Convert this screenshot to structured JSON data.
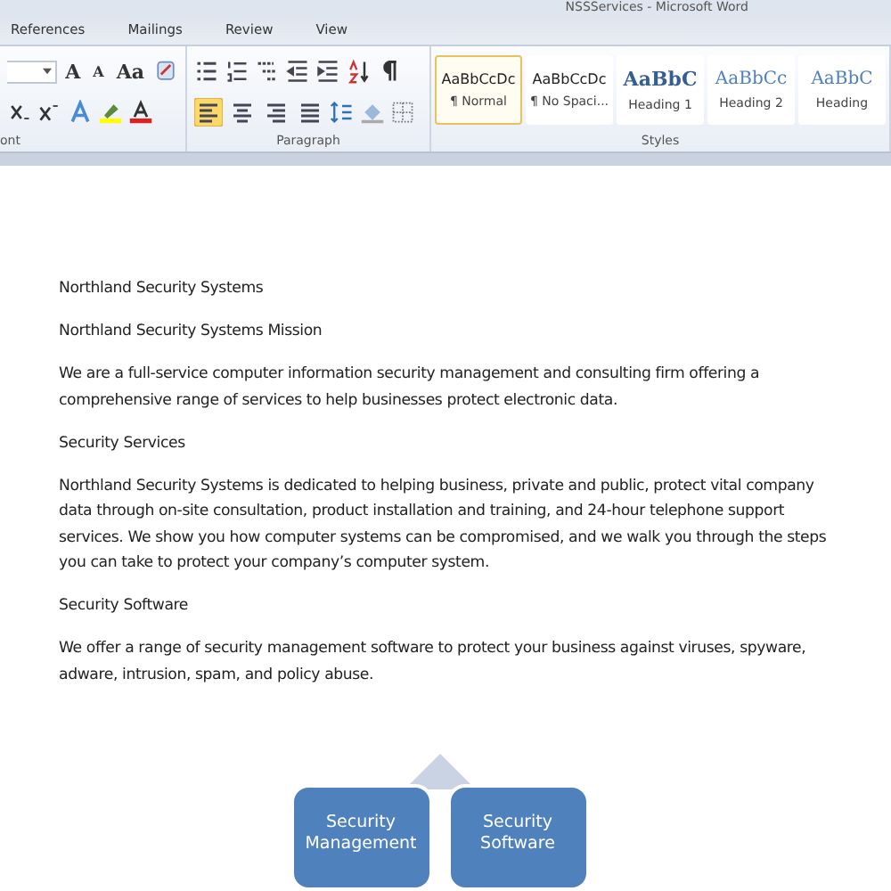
{
  "window": {
    "title": "NSSServices - Microsoft Word"
  },
  "ribbon_tabs": [
    {
      "label": "References",
      "selected": false
    },
    {
      "label": "Mailings",
      "selected": false
    },
    {
      "label": "Review",
      "selected": false
    },
    {
      "label": "View",
      "selected": false
    }
  ],
  "font_group": {
    "label": "ont",
    "tools": [
      "A",
      "A",
      "Aa"
    ]
  },
  "paragraph_group": {
    "label": "Paragraph",
    "alignment": [
      {
        "selected": true
      },
      {
        "selected": false
      },
      {
        "selected": false
      },
      {
        "selected": false
      }
    ]
  },
  "styles_group": {
    "label": "Styles",
    "styles": [
      {
        "preview": "AaBbCcDc",
        "name": "¶ Normal",
        "kind": "body",
        "selected": true
      },
      {
        "preview": "AaBbCcDc",
        "name": "¶ No Spaci...",
        "kind": "body",
        "selected": false
      },
      {
        "preview": "AaBbC",
        "name": "Heading 1",
        "kind": "heading1",
        "selected": false
      },
      {
        "preview": "AaBbCc",
        "name": "Heading 2",
        "kind": "heading2",
        "selected": false
      },
      {
        "preview": "AaBbC",
        "name": "Heading",
        "kind": "heading2",
        "selected": false
      }
    ]
  },
  "document": {
    "paragraphs": [
      "Northland Security Systems",
      "Northland Security Systems Mission",
      "We are a full-service computer information security management and consulting firm offering a comprehensive range of services to help businesses protect electronic data.",
      "Security Services",
      "Northland Security Systems is dedicated to helping business, private and public, protect vital company data through on-site consultation, product installation and training, and 24-hour telephone support services. We show you how computer systems can be compromised, and we walk you through the steps you can take to protect your company’s computer system.",
      "Security Software",
      "We offer a range of security management software to protect your business against viruses, spyware, adware, intrusion, spam, and policy abuse."
    ],
    "diagram": [
      "Security Management",
      "Security Software"
    ]
  }
}
